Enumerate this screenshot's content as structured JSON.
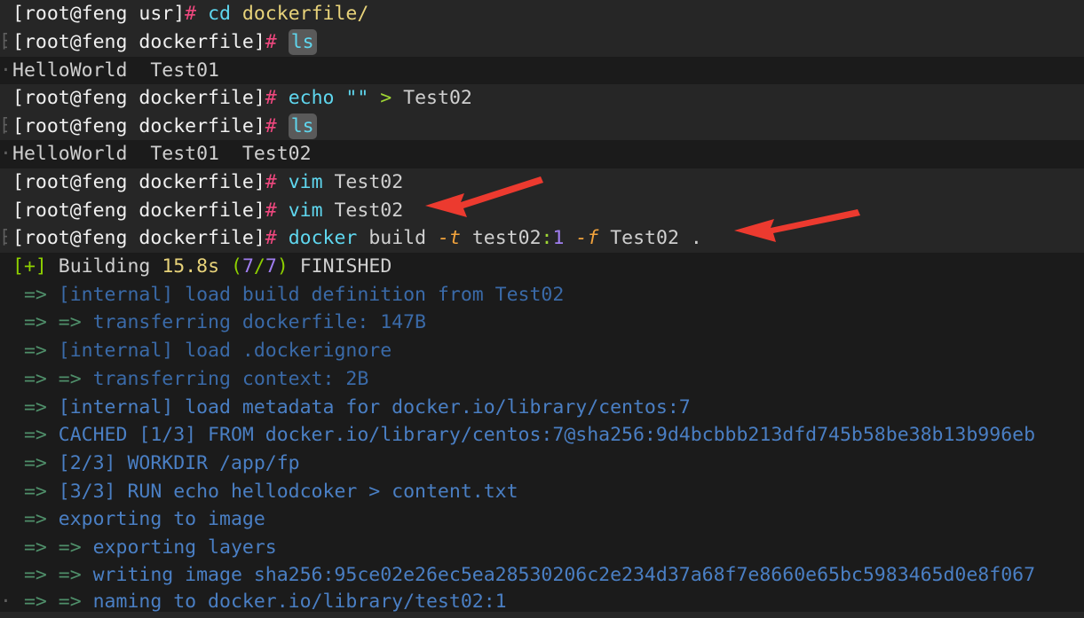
{
  "terminal": {
    "background_color": "#1b1b1b",
    "band_color_alt": "#262626",
    "font_size_px": 21.5,
    "colors": {
      "prompt": "#f0f0f0",
      "hash": "#f0487f",
      "command": "#5fd7ef",
      "path_arg": "#e8d37a",
      "redirect": "#9fd634",
      "flag": "#f2a33c",
      "number": "#a07ef0",
      "build_arrow": "#4f8f6a",
      "build_text": "#3a6aa8",
      "annotation_arrow": "#ec3a2f",
      "highlight_pill": "#5a5a5a"
    },
    "lines": [
      {
        "id": "line-1",
        "kind": "prompt",
        "prompt": "[root@feng usr]",
        "hash": "#",
        "command": "cd",
        "arg_path": "dockerfile/"
      },
      {
        "id": "line-2",
        "kind": "prompt",
        "prompt": "[root@feng dockerfile]",
        "hash": "#",
        "command": "ls",
        "highlighted": true,
        "ghost": "日"
      },
      {
        "id": "line-3",
        "kind": "output",
        "text": "HelloWorld  Test01",
        "ghost": "·"
      },
      {
        "id": "line-4",
        "kind": "prompt",
        "prompt": "[root@feng dockerfile]",
        "hash": "#",
        "command": "echo",
        "quote": "\"\"",
        "redirect": ">",
        "arg": "Test02"
      },
      {
        "id": "line-5",
        "kind": "prompt",
        "prompt": "[root@feng dockerfile]",
        "hash": "#",
        "command": "ls",
        "highlighted": true,
        "ghost": "日"
      },
      {
        "id": "line-6",
        "kind": "output",
        "text": "HelloWorld  Test01  Test02",
        "ghost": "·"
      },
      {
        "id": "line-7",
        "kind": "prompt",
        "prompt": "[root@feng dockerfile]",
        "hash": "#",
        "command": "vim",
        "arg": "Test02"
      },
      {
        "id": "line-8",
        "kind": "prompt",
        "prompt": "[root@feng dockerfile]",
        "hash": "#",
        "command": "vim",
        "arg": "Test02"
      },
      {
        "id": "line-9",
        "kind": "prompt-docker",
        "prompt": "[root@feng dockerfile]",
        "hash": "#",
        "command": "docker",
        "subcommand": "build",
        "flag_t": "-t",
        "image_name": "test02",
        "colon": ":",
        "image_tag": "1",
        "flag_f": "-f",
        "dockerfile": "Test02",
        "context": ".",
        "ghost": "日"
      },
      {
        "id": "line-10",
        "kind": "building",
        "bracket": "[+]",
        "label": "Building",
        "duration": "15.8s",
        "paren_open": "(",
        "steps_done": "7",
        "slash": "/",
        "steps_total": "7",
        "paren_close": ")",
        "status": "FINISHED"
      },
      {
        "id": "line-11",
        "kind": "build",
        "arrow": " => ",
        "text": "[internal] load build definition from Test02"
      },
      {
        "id": "line-12",
        "kind": "build",
        "arrow": " => => ",
        "text": "transferring dockerfile: 147B"
      },
      {
        "id": "line-13",
        "kind": "build",
        "arrow": " => ",
        "text": "[internal] load .dockerignore"
      },
      {
        "id": "line-14",
        "kind": "build",
        "arrow": " => => ",
        "text": "transferring context: 2B"
      },
      {
        "id": "line-15",
        "kind": "build",
        "arrow": " => ",
        "text": "[internal] load metadata for docker.io/library/centos:7"
      },
      {
        "id": "line-16",
        "kind": "build",
        "arrow": " => ",
        "text": "CACHED [1/3] FROM docker.io/library/centos:7@sha256:9d4bcbbb213dfd745b58be38b13b996eb"
      },
      {
        "id": "line-17",
        "kind": "build",
        "arrow": " => ",
        "text": "[2/3] WORKDIR /app/fp"
      },
      {
        "id": "line-18",
        "kind": "build",
        "arrow": " => ",
        "text": "[3/3] RUN echo hellodcoker > content.txt"
      },
      {
        "id": "line-19",
        "kind": "build",
        "arrow": " => ",
        "text": "exporting to image"
      },
      {
        "id": "line-20",
        "kind": "build",
        "arrow": " => => ",
        "text": "exporting layers"
      },
      {
        "id": "line-21",
        "kind": "build",
        "arrow": " => => ",
        "text": "writing image sha256:95ce02e26ec5ea28530206c2e234d37a68f7e8660e65bc5983465d0e8f067"
      },
      {
        "id": "line-22",
        "kind": "build",
        "arrow": " => => ",
        "text": "naming to docker.io/library/test02:1",
        "ghost": "·"
      }
    ],
    "annotations": [
      {
        "id": "annotation-arrow-1",
        "points_at": "vim Test02",
        "color": "#ec3a2f"
      },
      {
        "id": "annotation-arrow-2",
        "points_at": "docker build -t test02:1 -f Test02 .",
        "color": "#ec3a2f"
      }
    ]
  }
}
